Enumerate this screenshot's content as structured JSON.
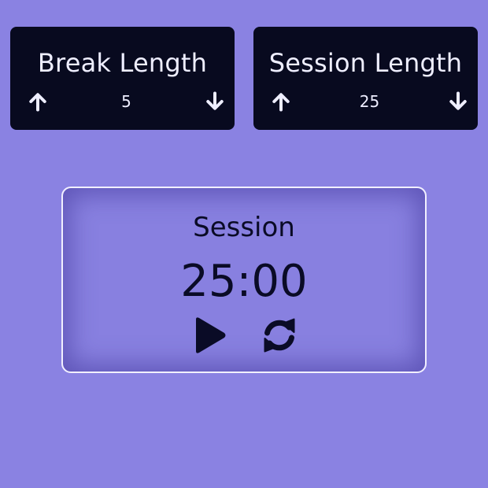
{
  "colors": {
    "background": "#8a82e2",
    "card_background": "#080a1f",
    "card_text": "#eeeeff",
    "timer_text": "#0a0b26",
    "timer_border": "#f2f0ff"
  },
  "break_length": {
    "title": "Break Length",
    "value": "5",
    "increment_icon": "arrow-up-icon",
    "decrement_icon": "arrow-down-icon"
  },
  "session_length": {
    "title": "Session Length",
    "value": "25",
    "increment_icon": "arrow-up-icon",
    "decrement_icon": "arrow-down-icon"
  },
  "timer": {
    "label": "Session",
    "time": "25:00",
    "play_icon": "play-icon",
    "reset_icon": "refresh-icon"
  }
}
